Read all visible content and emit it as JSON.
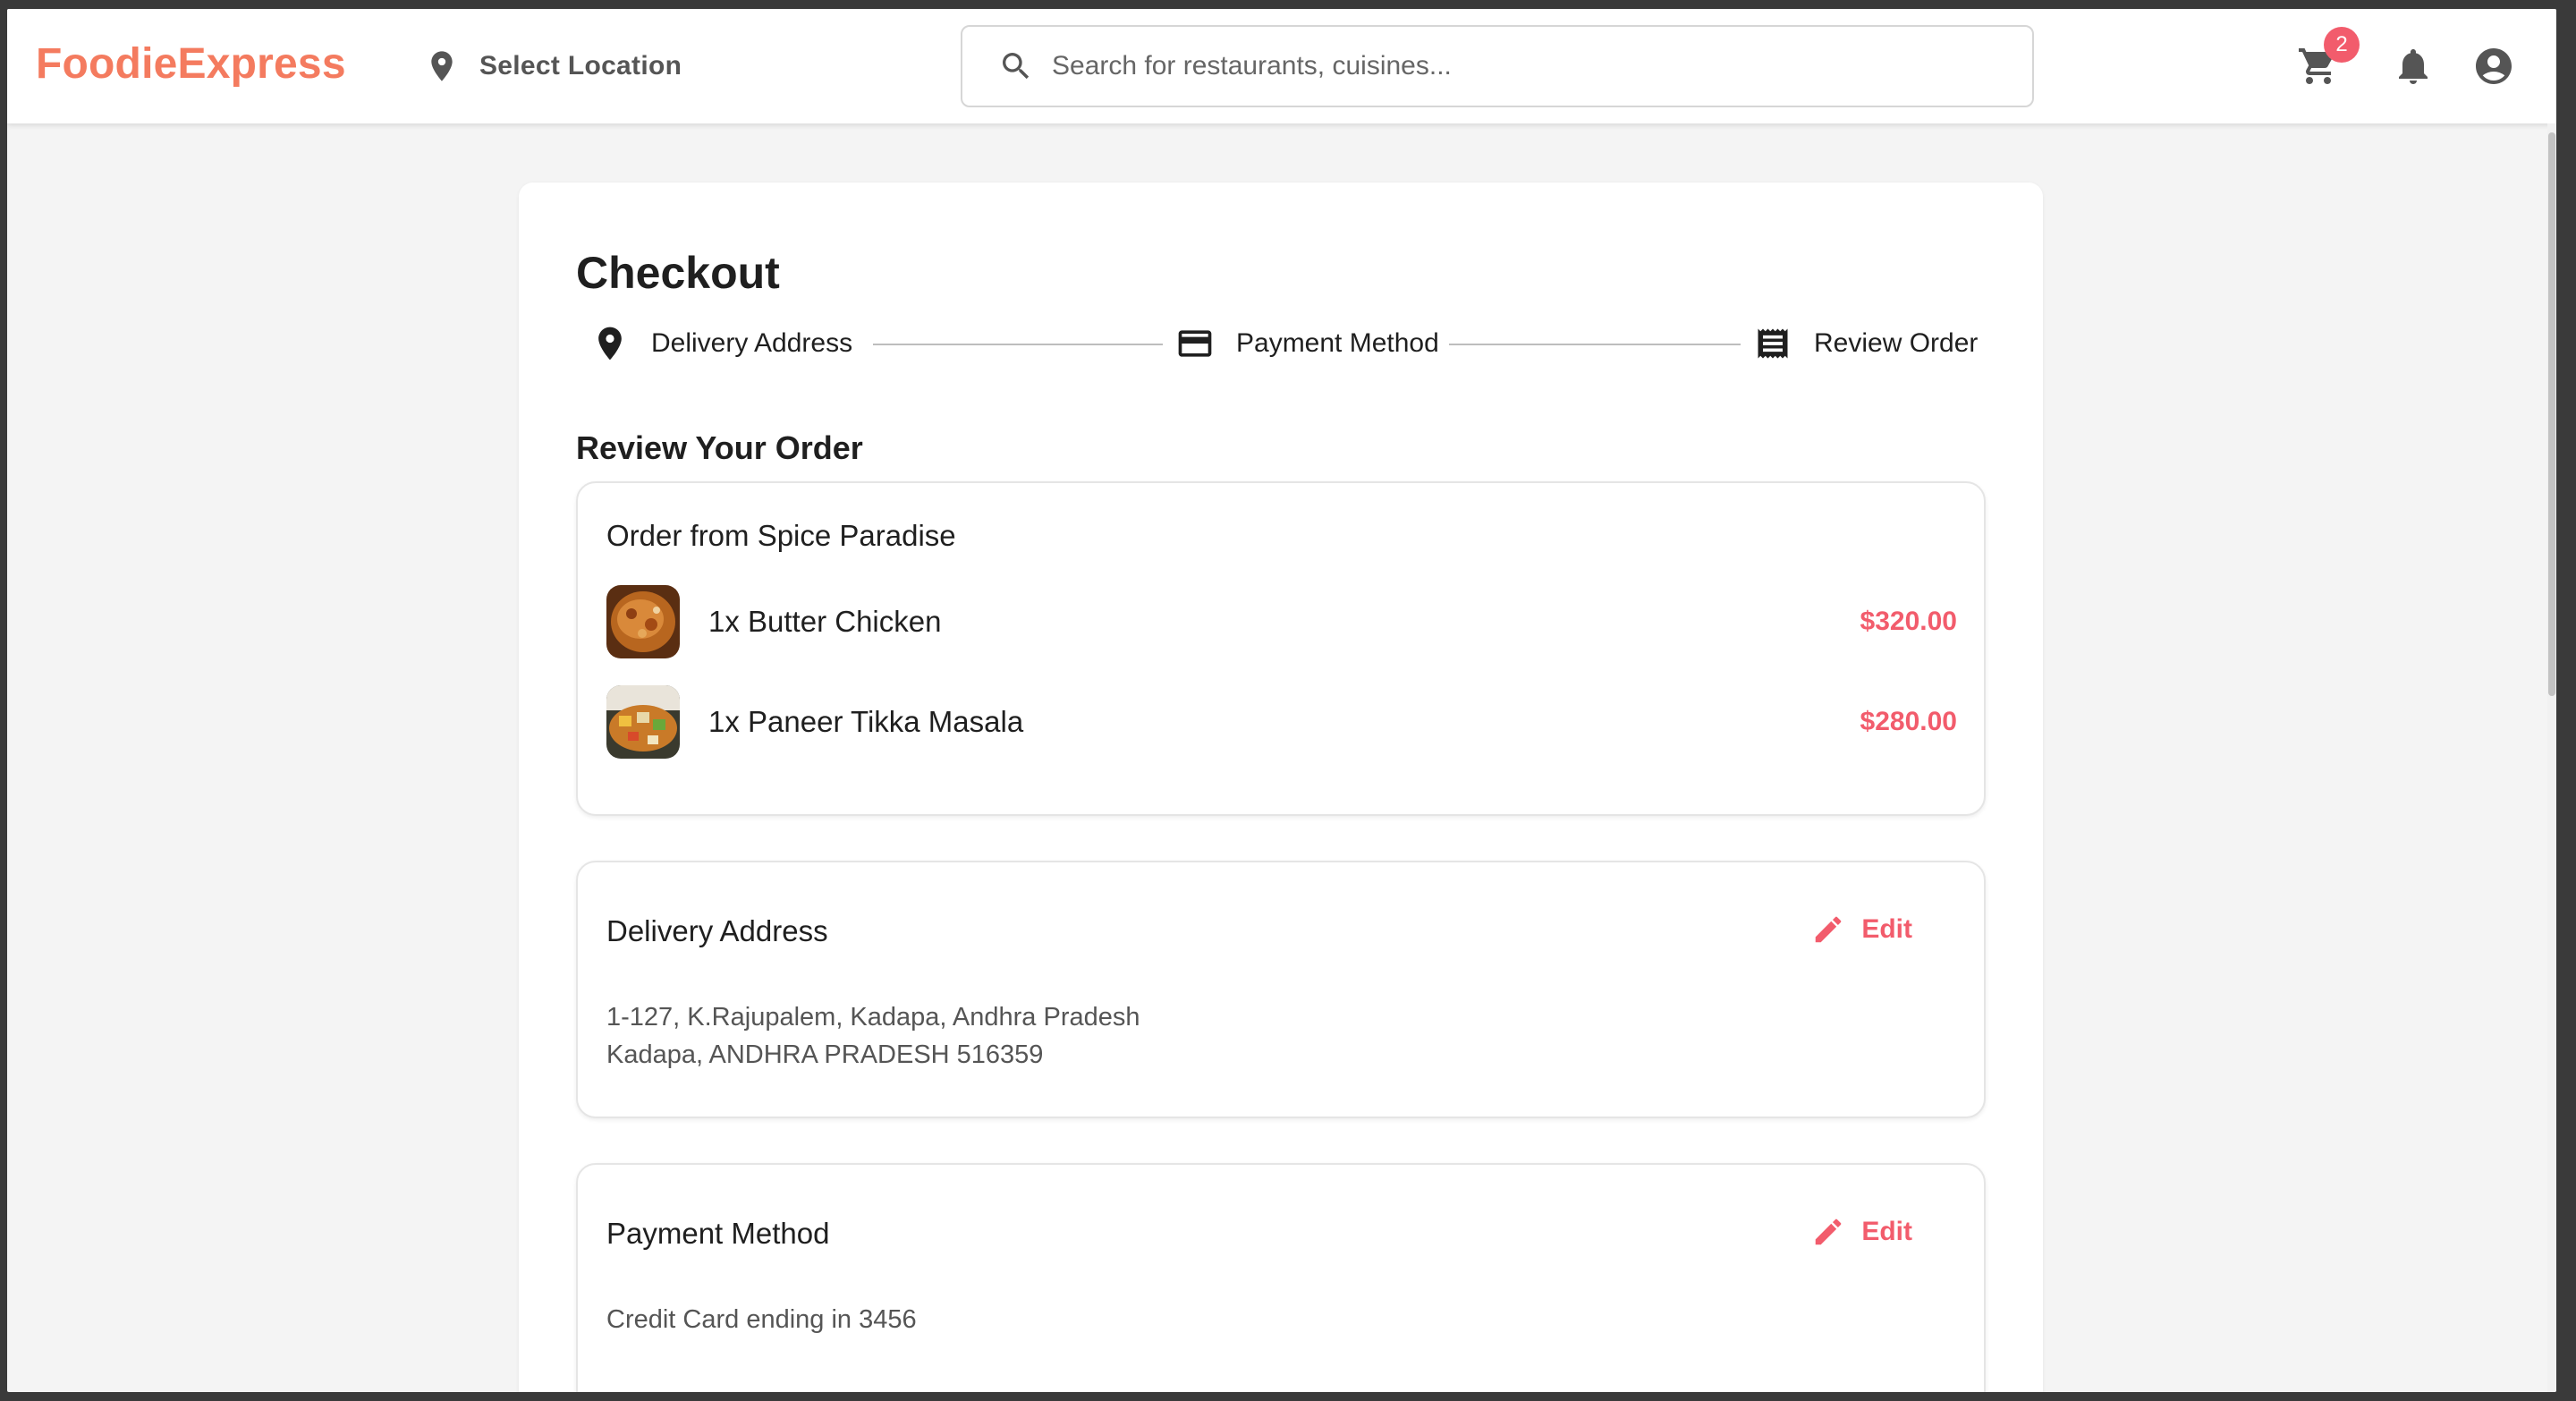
{
  "header": {
    "brand": "FoodieExpress",
    "location_label": "Select Location",
    "search_placeholder": "Search for restaurants, cuisines...",
    "cart_count": "2",
    "icons": [
      "location-pin-icon",
      "search-icon",
      "cart-icon",
      "bell-icon",
      "account-icon"
    ]
  },
  "checkout": {
    "title": "Checkout",
    "steps": [
      {
        "label": "Delivery Address",
        "icon": "location-pin-icon"
      },
      {
        "label": "Payment Method",
        "icon": "credit-card-icon"
      },
      {
        "label": "Review Order",
        "icon": "receipt-icon"
      }
    ],
    "section_title": "Review Your Order",
    "order": {
      "title": "Order from Spice Paradise",
      "items": [
        {
          "name": "1x Butter Chicken",
          "price": "$320.00"
        },
        {
          "name": "1x Paneer Tikka Masala",
          "price": "$280.00"
        }
      ]
    },
    "address": {
      "title": "Delivery Address",
      "edit_label": "Edit",
      "line1": "1-127, K.Rajupalem, Kadapa, Andhra Pradesh",
      "line2": "Kadapa, ANDHRA PRADESH 516359"
    },
    "payment": {
      "title": "Payment Method",
      "edit_label": "Edit",
      "detail": "Credit Card ending in 3456"
    }
  },
  "colors": {
    "brand": "#f47b5f",
    "accent": "#f25c6c",
    "background": "#f4f4f4"
  }
}
